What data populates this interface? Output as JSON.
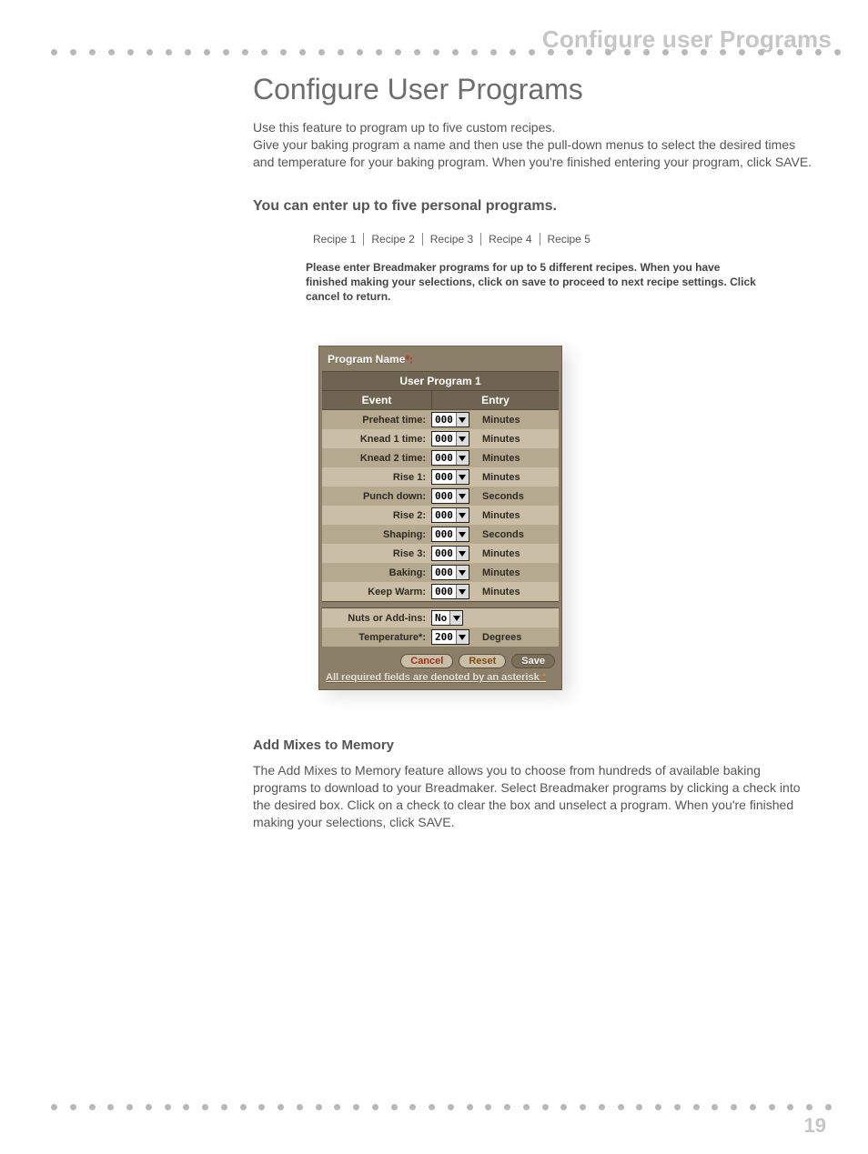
{
  "header": {
    "breadcrumb": "Configure user Programs"
  },
  "page": {
    "title": "Configure User Programs",
    "intro": "Use this feature to program up to five custom recipes.\nGive your baking program a name and then use the pull-down menus to select the desired times and temperature for your baking program. When you're finished entering your program, click SAVE.",
    "subhead": "You can enter up to five personal programs."
  },
  "tabs": [
    "Recipe 1",
    "Recipe 2",
    "Recipe 3",
    "Recipe 4",
    "Recipe 5"
  ],
  "tab_instructions": "Please enter Breadmaker programs for up to 5 different recipes. When you have finished making your selections, click on save to proceed to next recipe settings. Click cancel to return.",
  "form": {
    "panel_label": "Program Name",
    "panel_label_suffix": "*:",
    "subtitle": "User Program 1",
    "col_event": "Event",
    "col_entry": "Entry",
    "rows": [
      {
        "label": "Preheat time:",
        "value": "000",
        "unit": "Minutes"
      },
      {
        "label": "Knead 1 time:",
        "value": "000",
        "unit": "Minutes"
      },
      {
        "label": "Knead 2 time:",
        "value": "000",
        "unit": "Minutes"
      },
      {
        "label": "Rise 1:",
        "value": "000",
        "unit": "Minutes"
      },
      {
        "label": "Punch down:",
        "value": "000",
        "unit": "Seconds"
      },
      {
        "label": "Rise 2:",
        "value": "000",
        "unit": "Minutes"
      },
      {
        "label": "Shaping:",
        "value": "000",
        "unit": "Seconds"
      },
      {
        "label": "Rise 3:",
        "value": "000",
        "unit": "Minutes"
      },
      {
        "label": "Baking:",
        "value": "000",
        "unit": "Minutes"
      },
      {
        "label": "Keep Warm:",
        "value": "000",
        "unit": "Minutes"
      }
    ],
    "addins": {
      "label": "Nuts or Add-ins:",
      "value": "No"
    },
    "temperature": {
      "label": "Temperature*:",
      "value": "200",
      "unit": "Degrees"
    },
    "buttons": {
      "cancel": "Cancel",
      "reset": "Reset",
      "save": "Save"
    },
    "required_note": "All required fields are denoted by an asterisk"
  },
  "section2": {
    "heading": "Add Mixes to Memory",
    "body": "The Add Mixes to Memory feature allows you to choose from hundreds of available baking programs to download to your Breadmaker. Select Breadmaker programs by clicking a check into the desired box. Click on a check to clear the box and unselect a program. When you're finished making your selections, click SAVE."
  },
  "page_number": "19"
}
